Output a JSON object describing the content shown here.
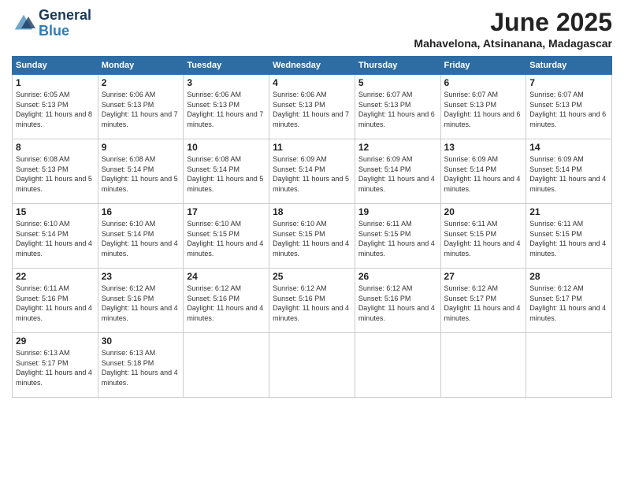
{
  "header": {
    "logo_line1": "General",
    "logo_line2": "Blue",
    "month": "June 2025",
    "location": "Mahavelona, Atsinanana, Madagascar"
  },
  "weekdays": [
    "Sunday",
    "Monday",
    "Tuesday",
    "Wednesday",
    "Thursday",
    "Friday",
    "Saturday"
  ],
  "weeks": [
    [
      {
        "day": "1",
        "sunrise": "6:05 AM",
        "sunset": "5:13 PM",
        "daylight": "11 hours and 8 minutes."
      },
      {
        "day": "2",
        "sunrise": "6:06 AM",
        "sunset": "5:13 PM",
        "daylight": "11 hours and 7 minutes."
      },
      {
        "day": "3",
        "sunrise": "6:06 AM",
        "sunset": "5:13 PM",
        "daylight": "11 hours and 7 minutes."
      },
      {
        "day": "4",
        "sunrise": "6:06 AM",
        "sunset": "5:13 PM",
        "daylight": "11 hours and 7 minutes."
      },
      {
        "day": "5",
        "sunrise": "6:07 AM",
        "sunset": "5:13 PM",
        "daylight": "11 hours and 6 minutes."
      },
      {
        "day": "6",
        "sunrise": "6:07 AM",
        "sunset": "5:13 PM",
        "daylight": "11 hours and 6 minutes."
      },
      {
        "day": "7",
        "sunrise": "6:07 AM",
        "sunset": "5:13 PM",
        "daylight": "11 hours and 6 minutes."
      }
    ],
    [
      {
        "day": "8",
        "sunrise": "6:08 AM",
        "sunset": "5:13 PM",
        "daylight": "11 hours and 5 minutes."
      },
      {
        "day": "9",
        "sunrise": "6:08 AM",
        "sunset": "5:14 PM",
        "daylight": "11 hours and 5 minutes."
      },
      {
        "day": "10",
        "sunrise": "6:08 AM",
        "sunset": "5:14 PM",
        "daylight": "11 hours and 5 minutes."
      },
      {
        "day": "11",
        "sunrise": "6:09 AM",
        "sunset": "5:14 PM",
        "daylight": "11 hours and 5 minutes."
      },
      {
        "day": "12",
        "sunrise": "6:09 AM",
        "sunset": "5:14 PM",
        "daylight": "11 hours and 4 minutes."
      },
      {
        "day": "13",
        "sunrise": "6:09 AM",
        "sunset": "5:14 PM",
        "daylight": "11 hours and 4 minutes."
      },
      {
        "day": "14",
        "sunrise": "6:09 AM",
        "sunset": "5:14 PM",
        "daylight": "11 hours and 4 minutes."
      }
    ],
    [
      {
        "day": "15",
        "sunrise": "6:10 AM",
        "sunset": "5:14 PM",
        "daylight": "11 hours and 4 minutes."
      },
      {
        "day": "16",
        "sunrise": "6:10 AM",
        "sunset": "5:14 PM",
        "daylight": "11 hours and 4 minutes."
      },
      {
        "day": "17",
        "sunrise": "6:10 AM",
        "sunset": "5:15 PM",
        "daylight": "11 hours and 4 minutes."
      },
      {
        "day": "18",
        "sunrise": "6:10 AM",
        "sunset": "5:15 PM",
        "daylight": "11 hours and 4 minutes."
      },
      {
        "day": "19",
        "sunrise": "6:11 AM",
        "sunset": "5:15 PM",
        "daylight": "11 hours and 4 minutes."
      },
      {
        "day": "20",
        "sunrise": "6:11 AM",
        "sunset": "5:15 PM",
        "daylight": "11 hours and 4 minutes."
      },
      {
        "day": "21",
        "sunrise": "6:11 AM",
        "sunset": "5:15 PM",
        "daylight": "11 hours and 4 minutes."
      }
    ],
    [
      {
        "day": "22",
        "sunrise": "6:11 AM",
        "sunset": "5:16 PM",
        "daylight": "11 hours and 4 minutes."
      },
      {
        "day": "23",
        "sunrise": "6:12 AM",
        "sunset": "5:16 PM",
        "daylight": "11 hours and 4 minutes."
      },
      {
        "day": "24",
        "sunrise": "6:12 AM",
        "sunset": "5:16 PM",
        "daylight": "11 hours and 4 minutes."
      },
      {
        "day": "25",
        "sunrise": "6:12 AM",
        "sunset": "5:16 PM",
        "daylight": "11 hours and 4 minutes."
      },
      {
        "day": "26",
        "sunrise": "6:12 AM",
        "sunset": "5:16 PM",
        "daylight": "11 hours and 4 minutes."
      },
      {
        "day": "27",
        "sunrise": "6:12 AM",
        "sunset": "5:17 PM",
        "daylight": "11 hours and 4 minutes."
      },
      {
        "day": "28",
        "sunrise": "6:12 AM",
        "sunset": "5:17 PM",
        "daylight": "11 hours and 4 minutes."
      }
    ],
    [
      {
        "day": "29",
        "sunrise": "6:13 AM",
        "sunset": "5:17 PM",
        "daylight": "11 hours and 4 minutes."
      },
      {
        "day": "30",
        "sunrise": "6:13 AM",
        "sunset": "5:18 PM",
        "daylight": "11 hours and 4 minutes."
      },
      null,
      null,
      null,
      null,
      null
    ]
  ]
}
